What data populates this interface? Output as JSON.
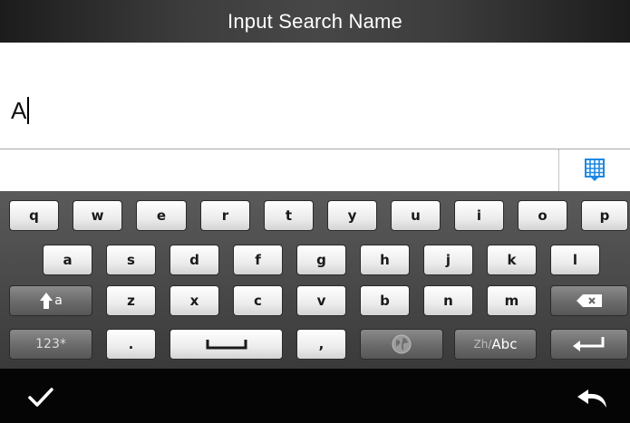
{
  "header": {
    "title": "Input Search Name"
  },
  "input": {
    "value": "A"
  },
  "candidate_bar": {
    "layout_icon": "grid-keyboard-icon"
  },
  "keyboard": {
    "row1": [
      "q",
      "w",
      "e",
      "r",
      "t",
      "y",
      "u",
      "i",
      "o",
      "p"
    ],
    "row2": [
      "a",
      "s",
      "d",
      "f",
      "g",
      "h",
      "j",
      "k",
      "l"
    ],
    "row3": [
      "z",
      "x",
      "c",
      "v",
      "b",
      "n",
      "m"
    ],
    "shift": {
      "label": "a",
      "icon": "shift-arrow-icon"
    },
    "backspace": {
      "icon": "backspace-icon"
    },
    "numbers_label": "123*",
    "period_label": ".",
    "space_icon": "space-bar-icon",
    "comma_label": ",",
    "globe_icon": "globe-icon",
    "lang": {
      "prefix": "Zh/",
      "label": "Abc"
    },
    "enter_icon": "enter-arrow-icon"
  },
  "bottom_bar": {
    "confirm_icon": "checkmark-icon",
    "back_icon": "back-arrow-icon"
  },
  "colors": {
    "accent": "#1e88e5",
    "keyboard_bg": "#444444",
    "title_bg": "#3a3a3a"
  }
}
